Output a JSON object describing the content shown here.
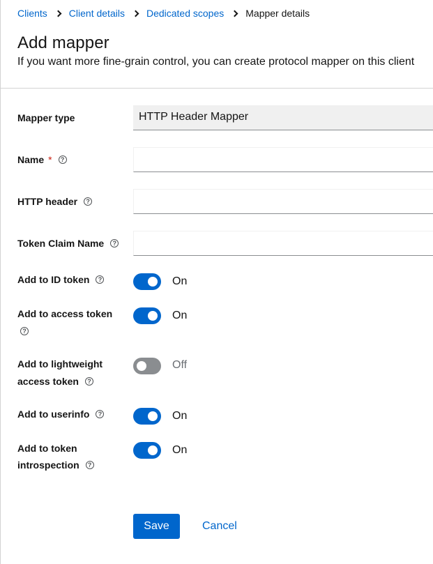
{
  "breadcrumb": {
    "items": [
      {
        "label": "Clients"
      },
      {
        "label": "Client details"
      },
      {
        "label": "Dedicated scopes"
      }
    ],
    "current": "Mapper details"
  },
  "header": {
    "title": "Add mapper",
    "description": "If you want more fine-grain control, you can create protocol mapper on this client"
  },
  "form": {
    "mapper_type": {
      "label": "Mapper type",
      "value": "HTTP Header Mapper"
    },
    "name": {
      "label": "Name",
      "required_mark": "*",
      "value": ""
    },
    "http_header": {
      "label": "HTTP header",
      "value": ""
    },
    "token_claim_name": {
      "label": "Token Claim Name",
      "value": ""
    },
    "help_glyph": "?",
    "toggles": {
      "id_token": {
        "label": "Add to ID token",
        "state": "On"
      },
      "access_token": {
        "label": "Add to access token",
        "state": "On"
      },
      "lightweight": {
        "label_line1": "Add to lightweight",
        "label_line2": "access token",
        "state": "Off"
      },
      "userinfo": {
        "label": "Add to userinfo",
        "state": "On"
      },
      "introspection": {
        "label_line1": "Add to token",
        "label_line2": "introspection",
        "state": "On"
      }
    }
  },
  "actions": {
    "save_label": "Save",
    "cancel_label": "Cancel"
  },
  "colors": {
    "accent": "#0066cc",
    "required": "#c9190b",
    "toggle_off": "#8a8d90"
  }
}
